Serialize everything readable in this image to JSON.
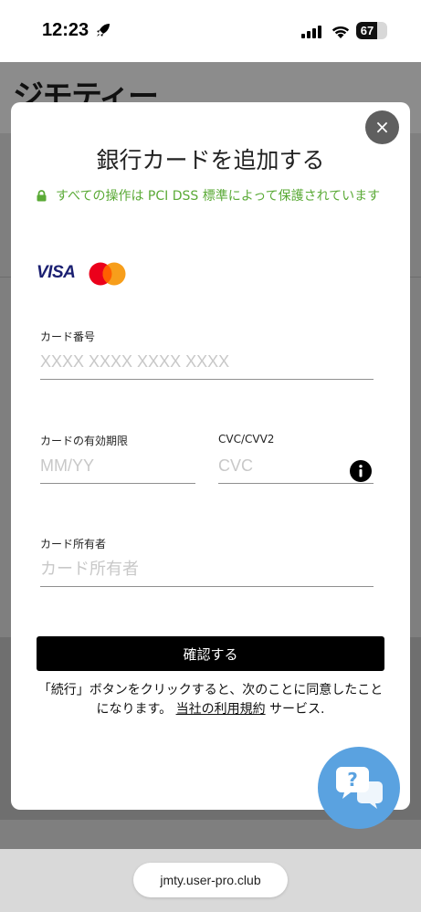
{
  "status_bar": {
    "time": "12:23",
    "battery": "67",
    "battery_level": 0.67
  },
  "background": {
    "logo_text": "ジモティー"
  },
  "modal": {
    "title": "銀行カードを追加する",
    "secure_note": "すべての操作は PCI DSS 標準によって保護されています",
    "card_brands": {
      "visa": "VISA"
    },
    "fields": {
      "card_number": {
        "label": "カード番号",
        "placeholder": "XXXX XXXX XXXX XXXX",
        "value": ""
      },
      "expiry": {
        "label": "カードの有効期限",
        "placeholder": "MM/YY",
        "value": ""
      },
      "cvc": {
        "label": "CVC/CVV2",
        "placeholder": "CVC",
        "value": ""
      },
      "holder": {
        "label": "カード所有者",
        "placeholder": "カード所有者",
        "value": ""
      }
    },
    "confirm_label": "確認する",
    "consent": {
      "prefix": "「続行」ボタンをクリックすると、次のことに同意したことになります。",
      "link": "当社の利用規約",
      "suffix": "サービス."
    },
    "close_label": "×"
  },
  "browser": {
    "url": "jmty.user-pro.club"
  },
  "colors": {
    "secure_green": "#5aaa36",
    "button_black": "#000000",
    "chat_blue": "#5aa2e0"
  }
}
